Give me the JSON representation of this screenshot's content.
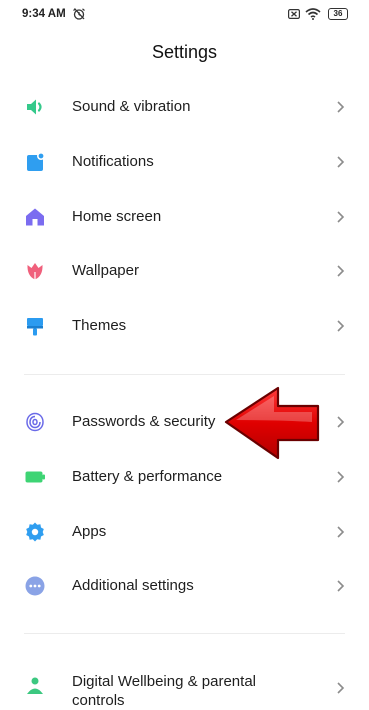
{
  "status_bar": {
    "time": "9:34 AM",
    "battery": "36",
    "icons": [
      "alarm-off-icon",
      "sim-x-icon",
      "wifi-icon",
      "battery-icon"
    ]
  },
  "header": {
    "title": "Settings"
  },
  "settings": [
    {
      "label": "Sound & vibration",
      "icon": "speaker-icon",
      "color": "#35c98b"
    },
    {
      "label": "Notifications",
      "icon": "notification-icon",
      "color": "#2f9ef0"
    },
    {
      "label": "Home screen",
      "icon": "home-icon",
      "color": "#7b6cf0"
    },
    {
      "label": "Wallpaper",
      "icon": "tulip-icon",
      "color": "#f0607c"
    },
    {
      "label": "Themes",
      "icon": "brush-icon",
      "color": "#2b9bf0"
    },
    {
      "label": "Passwords & security",
      "icon": "fingerprint-icon",
      "color": "#6a6ae8"
    },
    {
      "label": "Battery & performance",
      "icon": "battery-icon",
      "color": "#3ed474"
    },
    {
      "label": "Apps",
      "icon": "gear-icon",
      "color": "#2f9ef0"
    },
    {
      "label": "Additional settings",
      "icon": "more-dots-icon",
      "color": "#8aa3e6"
    },
    {
      "label": "Digital Wellbeing & parental controls",
      "icon": "wellbeing-icon",
      "color": "#3cc880"
    }
  ],
  "annotation": {
    "arrow_color": "#d40000",
    "points_to": "Passwords & security"
  }
}
